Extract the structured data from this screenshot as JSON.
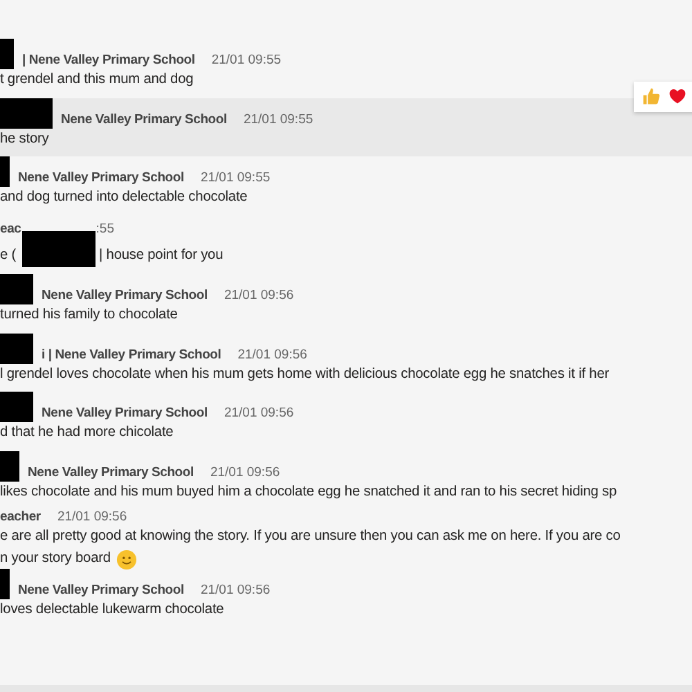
{
  "messages": [
    {
      "kind": "plain",
      "redacted": true,
      "highlighted": false,
      "sender": "| Nene Valley Primary School",
      "time": "21/01 09:55",
      "lines": [
        "t grendel and this mum and dog"
      ]
    },
    {
      "kind": "plain",
      "redacted": true,
      "highlighted": true,
      "sender": "Nene Valley Primary School",
      "time": "21/01 09:55",
      "lines": [
        "he story"
      ]
    },
    {
      "kind": "plain",
      "redacted": true,
      "highlighted": false,
      "sender": "Nene Valley Primary School",
      "time": "21/01 09:55",
      "lines": [
        "and dog turned into delectable chocolate"
      ]
    },
    {
      "kind": "inline-redaction",
      "redacted": true,
      "highlighted": false,
      "sender": "eac",
      "time": ":55",
      "lines": [
        "e (",
        "| house point for you"
      ]
    },
    {
      "kind": "plain",
      "redacted": true,
      "highlighted": false,
      "sender": "Nene Valley Primary School",
      "time": "21/01 09:56",
      "lines": [
        "turned his family to chocolate"
      ]
    },
    {
      "kind": "plain",
      "redacted": true,
      "highlighted": false,
      "sender": "i | Nene Valley Primary School",
      "time": "21/01 09:56",
      "lines": [
        "l grendel loves chocolate when his mum gets home with delicious chocolate egg he snatches it if her"
      ]
    },
    {
      "kind": "plain",
      "redacted": true,
      "highlighted": false,
      "sender": "Nene Valley Primary School",
      "time": "21/01 09:56",
      "lines": [
        "d that he had more chicolate"
      ]
    },
    {
      "kind": "plain",
      "redacted": true,
      "highlighted": false,
      "sender": "Nene Valley Primary School",
      "time": "21/01 09:56",
      "lines": [
        "likes chocolate and his mum buyed him a chocolate egg he snatched it and ran to his secret hiding sp"
      ]
    },
    {
      "kind": "emoji-end",
      "redacted": false,
      "highlighted": false,
      "sender": "eacher",
      "time": "21/01 09:56",
      "lines": [
        "e are all pretty good at knowing the story. If you are unsure then you can ask me on here. If you are co",
        "n your story board"
      ]
    },
    {
      "kind": "plain",
      "redacted": true,
      "highlighted": false,
      "sender": "Nene Valley Primary School",
      "time": "21/01 09:56",
      "lines": [
        "loves delectable lukewarm chocolate"
      ]
    }
  ]
}
